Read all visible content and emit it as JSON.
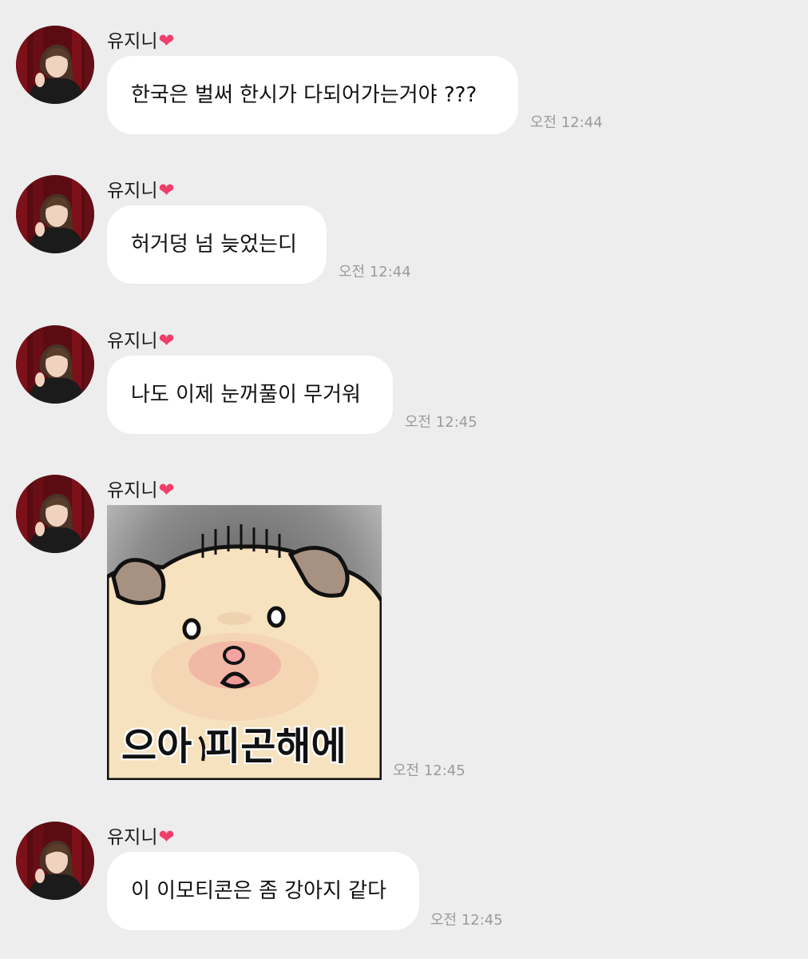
{
  "messages": [
    {
      "sender": "유지니",
      "heart": "❤",
      "text": "한국은 벌써 한시가 다되어가는거야 ???",
      "time": "오전 12:44"
    },
    {
      "sender": "유지니",
      "heart": "❤",
      "text": "허거덩 넘 늦었는디",
      "time": "오전 12:44"
    },
    {
      "sender": "유지니",
      "heart": "❤",
      "text": "나도 이제 눈꺼풀이 무거워",
      "time": "오전 12:45"
    },
    {
      "sender": "유지니",
      "heart": "❤",
      "sticker_caption": "으아 피곤해에",
      "time": "오전 12:45"
    },
    {
      "sender": "유지니",
      "heart": "❤",
      "text": "이 이모티콘은 좀 강아지 같다",
      "time": "오전 12:45"
    }
  ],
  "colors": {
    "background": "#ededed",
    "bubble": "#ffffff",
    "heart": "#f03e6a",
    "timestamp": "#9b9b9b"
  },
  "icons": [
    "avatar-photo",
    "heart-emoji",
    "sleepy-hamster-sticker"
  ]
}
